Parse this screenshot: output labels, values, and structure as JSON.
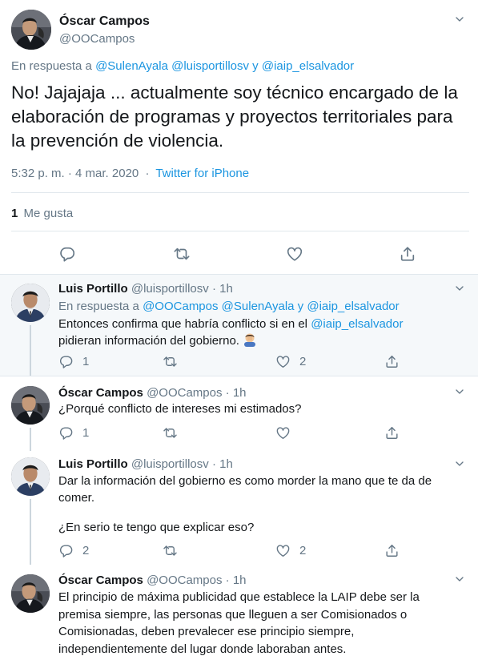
{
  "main_tweet": {
    "author_name": "Óscar Campos",
    "author_handle": "@OOCampos",
    "reply_prefix": "En respuesta a",
    "reply_to": "@SulenAyala @luisportillosv y @iaip_elsalvador",
    "text": "No! Jajajaja ... actualmente soy técnico encargado de la elaboración de programas y proyectos territoriales para la prevención de violencia.",
    "time": "5:32 p. m. · 4 mar. 2020",
    "dot": "·",
    "source": "Twitter for iPhone",
    "likes_count": "1",
    "likes_label": "Me gusta"
  },
  "replies": [
    {
      "name": "Luis Portillo",
      "handle": "@luisportillosv",
      "sep": "·",
      "age": "1h",
      "reply_prefix": "En respuesta a",
      "reply_to": "@OOCampos @SulenAyala y @iaip_elsalvador",
      "text_before": "Entonces confirma que habría conflicto si en el ",
      "text_link": "@iaip_elsalvador",
      "text_after": " pidieran información del gobierno.",
      "emoji": "man-facepalming",
      "reply_count": "1",
      "like_count": "2"
    },
    {
      "name": "Óscar Campos",
      "handle": "@OOCampos",
      "sep": "·",
      "age": "1h",
      "text": "¿Porqué conflicto de intereses mi estimados?",
      "reply_count": "1"
    },
    {
      "name": "Luis Portillo",
      "handle": "@luisportillosv",
      "sep": "·",
      "age": "1h",
      "text1": "Dar la información del gobierno es como morder la mano que te da de comer.",
      "text2": "¿En serio te tengo que explicar eso?",
      "reply_count": "2",
      "like_count": "2"
    },
    {
      "name": "Óscar Campos",
      "handle": "@OOCampos",
      "sep": "·",
      "age": "1h",
      "text": "El principio de máxima publicidad que establece la LAIP debe ser la premisa siempre, las personas que lleguen a ser Comisionados o Comisionadas, deben prevalecer ese principio siempre, independientemente del lugar donde laboraban antes."
    }
  ],
  "colors": {
    "link": "#1b95e0",
    "muted": "#657786",
    "highlight_bg": "#f5f8fa",
    "border": "#e1e8ed"
  },
  "icons": [
    "chevron-down-icon",
    "reply-icon",
    "retweet-icon",
    "like-icon",
    "share-icon"
  ]
}
